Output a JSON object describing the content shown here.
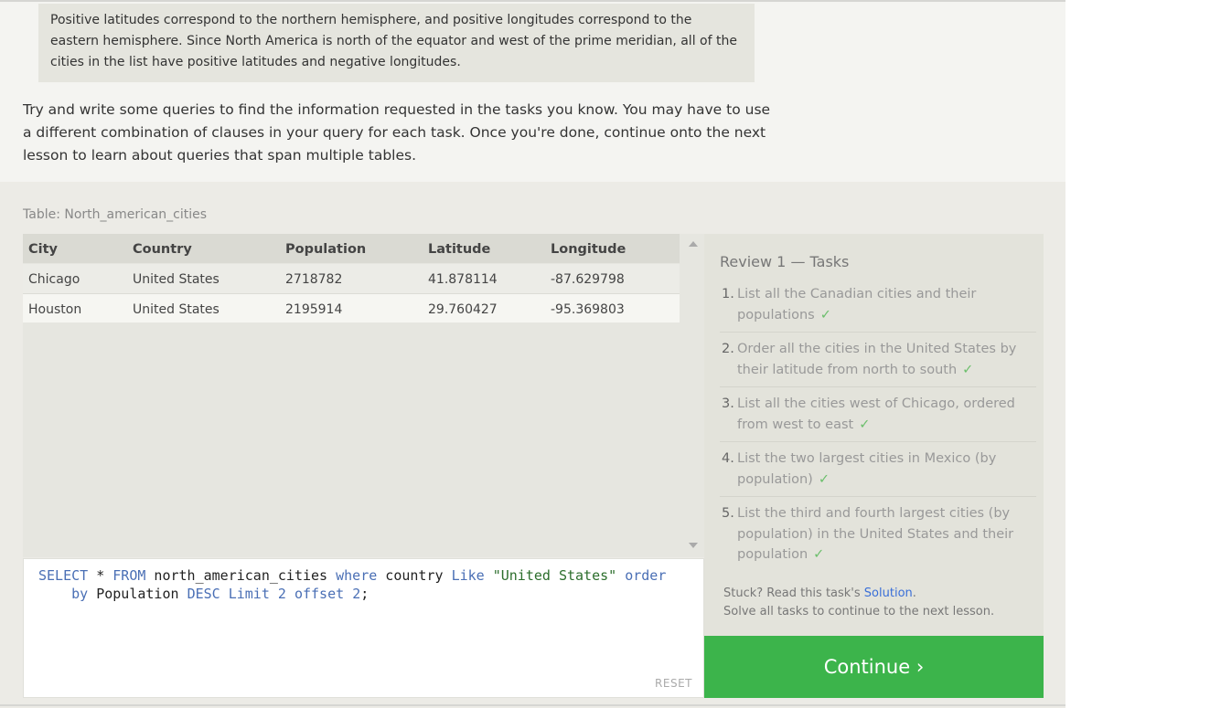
{
  "note_text": "Positive latitudes correspond to the northern hemisphere, and positive longitudes correspond to the eastern hemisphere. Since North America is north of the equator and west of the prime meridian, all of the cities in the list have positive latitudes and negative longitudes.",
  "intro_text": "Try and write some queries to find the information requested in the tasks you know. You may have to use a different combination of clauses in your query for each task. Once you're done, continue onto the next lesson to learn about queries that span multiple tables.",
  "table_label": "Table: North_american_cities",
  "table": {
    "columns": [
      "City",
      "Country",
      "Population",
      "Latitude",
      "Longitude"
    ],
    "rows": [
      [
        "Chicago",
        "United States",
        "2718782",
        "41.878114",
        "-87.629798"
      ],
      [
        "Houston",
        "United States",
        "2195914",
        "29.760427",
        "-95.369803"
      ]
    ]
  },
  "editor": {
    "sql": {
      "t1": "SELECT",
      "t2": " * ",
      "t3": "FROM",
      "t4": " north_american_cities ",
      "t5": "where",
      "t6": " country ",
      "t7": "Like",
      "t8": " ",
      "t9": "\"United States\"",
      "t10": " ",
      "t11": "order",
      "t12": "\n    ",
      "t13": "by",
      "t14": " Population ",
      "t15": "DESC",
      "t16": " ",
      "t17": "Limit",
      "t18": " ",
      "t19": "2",
      "t20": " ",
      "t21": "offset",
      "t22": " ",
      "t23": "2",
      "t24": ";"
    },
    "reset_label": "RESET"
  },
  "tasks": {
    "title": "Review 1 — Tasks",
    "items": [
      {
        "num": "1.",
        "text": "List all the Canadian cities and their populations",
        "check": "✓"
      },
      {
        "num": "2.",
        "text": "Order all the cities in the United States by their latitude from north to south",
        "check": "✓"
      },
      {
        "num": "3.",
        "text": "List all the cities west of Chicago, ordered from west to east",
        "check": "✓"
      },
      {
        "num": "4.",
        "text": "List the two largest cities in Mexico (by population)",
        "check": "✓"
      },
      {
        "num": "5.",
        "text": "List the third and fourth largest cities (by population) in the United States and their population",
        "check": "✓"
      }
    ],
    "stuck_prefix": "Stuck? Read this task's ",
    "solution_link": "Solution",
    "stuck_suffix": ".",
    "solve_all": "Solve all tasks to continue to the next lesson."
  },
  "continue_label": "Continue ›",
  "colors": {
    "continue_bg": "#3cb44b",
    "link": "#3a6fd8",
    "check": "#6cbf6c",
    "keyword": "#4a6fb5",
    "string": "#2c6e2c"
  }
}
